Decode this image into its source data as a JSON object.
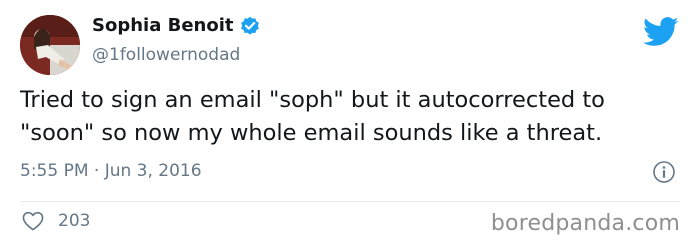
{
  "author": {
    "display_name": "Sophia Benoit",
    "handle": "@1followernodad",
    "verified": true
  },
  "tweet": {
    "text": "Tried to sign an email \"soph\" but it autocorrected to\n\"soon\" so now my whole email sounds like a threat.",
    "timestamp": "5:55 PM · Jun 3, 2016",
    "like_count": "203"
  },
  "icons": {
    "verified": "verified-badge-icon",
    "brand": "twitter-bird-icon",
    "info": "info-icon",
    "like": "heart-icon"
  },
  "colors": {
    "accent": "#1da1f2",
    "secondary_text": "#657786",
    "primary_text": "#14171a"
  },
  "watermark": "boredpanda.com"
}
